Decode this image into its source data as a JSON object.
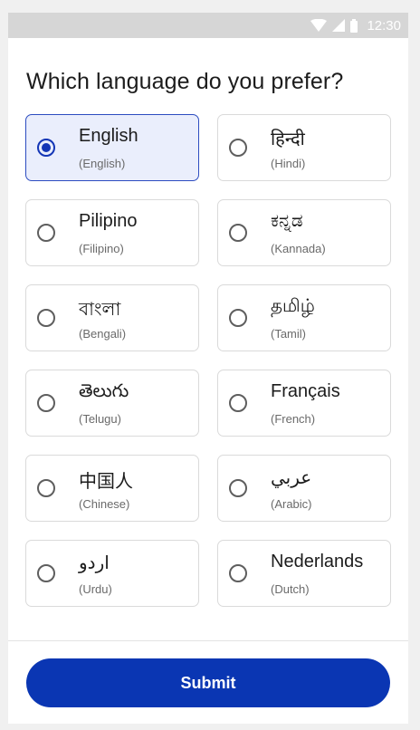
{
  "status_bar": {
    "time": "12:30",
    "icons": [
      "wifi-icon",
      "cellular-signal-icon",
      "battery-icon"
    ]
  },
  "question": "Which language do you prefer?",
  "languages": [
    {
      "native": "English",
      "english": "(English)",
      "selected": true
    },
    {
      "native": "हिन्दी",
      "english": "(Hindi)",
      "selected": false
    },
    {
      "native": "Pilipino",
      "english": "(Filipino)",
      "selected": false
    },
    {
      "native": "ಕನ್ನಡ",
      "english": "(Kannada)",
      "selected": false
    },
    {
      "native": "বাংলা",
      "english": "(Bengali)",
      "selected": false
    },
    {
      "native": "தமிழ்",
      "english": "(Tamil)",
      "selected": false
    },
    {
      "native": "తెలుగు",
      "english": "(Telugu)",
      "selected": false
    },
    {
      "native": "Français",
      "english": "(French)",
      "selected": false
    },
    {
      "native": "中国人",
      "english": "(Chinese)",
      "selected": false
    },
    {
      "native": "عربي",
      "english": "(Arabic)",
      "selected": false
    },
    {
      "native": "اردو",
      "english": "(Urdu)",
      "selected": false
    },
    {
      "native": "Nederlands",
      "english": "(Dutch)",
      "selected": false
    }
  ],
  "submit_label": "Submit",
  "colors": {
    "accent": "#0a36b3",
    "selected_bg": "#eaeefc",
    "status_bar": "#d6d6d6"
  }
}
